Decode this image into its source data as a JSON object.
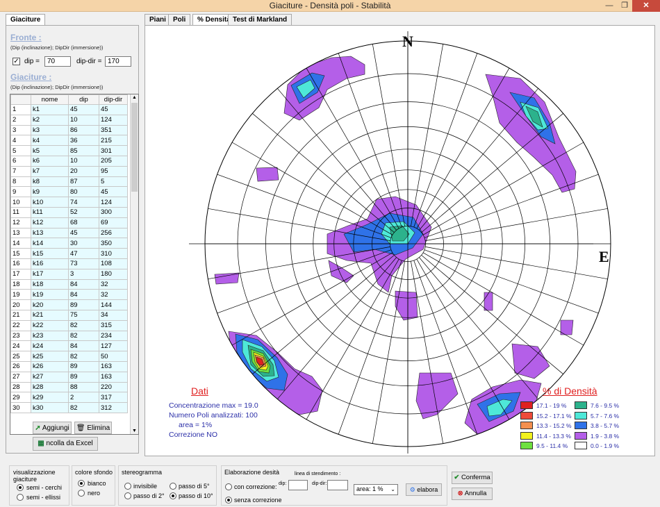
{
  "window": {
    "title": "Giaciture - Densità poli - Stabilità"
  },
  "left": {
    "tab": "Giaciture",
    "fronte_label": "Fronte :",
    "fronte_hint": "(Dip (inclinazione); DipDir (immersione))",
    "dip_label": "dip =",
    "dip_value": "70",
    "dipdir_label": "dip-dir =",
    "dipdir_value": "170",
    "giaciture_label": "Giaciture :",
    "giaciture_hint": "(Dip (inclinazione); DipDir (immersione))",
    "columns": [
      "nome",
      "dip",
      "dip-dir"
    ],
    "rows": [
      [
        "1",
        "k1",
        "45",
        "45"
      ],
      [
        "2",
        "k2",
        "10",
        "124"
      ],
      [
        "3",
        "k3",
        "86",
        "351"
      ],
      [
        "4",
        "k4",
        "36",
        "215"
      ],
      [
        "5",
        "k5",
        "85",
        "301"
      ],
      [
        "6",
        "k6",
        "10",
        "205"
      ],
      [
        "7",
        "k7",
        "20",
        "95"
      ],
      [
        "8",
        "k8",
        "87",
        "5"
      ],
      [
        "9",
        "k9",
        "80",
        "45"
      ],
      [
        "10",
        "k10",
        "74",
        "124"
      ],
      [
        "11",
        "k11",
        "52",
        "300"
      ],
      [
        "12",
        "k12",
        "68",
        "69"
      ],
      [
        "13",
        "k13",
        "45",
        "256"
      ],
      [
        "14",
        "k14",
        "30",
        "350"
      ],
      [
        "15",
        "k15",
        "47",
        "310"
      ],
      [
        "16",
        "k16",
        "73",
        "108"
      ],
      [
        "17",
        "k17",
        "3",
        "180"
      ],
      [
        "18",
        "k18",
        "84",
        "32"
      ],
      [
        "19",
        "k19",
        "84",
        "32"
      ],
      [
        "20",
        "k20",
        "89",
        "144"
      ],
      [
        "21",
        "k21",
        "75",
        "34"
      ],
      [
        "22",
        "k22",
        "82",
        "315"
      ],
      [
        "23",
        "k23",
        "82",
        "234"
      ],
      [
        "24",
        "k24",
        "84",
        "127"
      ],
      [
        "25",
        "k25",
        "82",
        "50"
      ],
      [
        "26",
        "k26",
        "89",
        "163"
      ],
      [
        "27",
        "k27",
        "89",
        "163"
      ],
      [
        "28",
        "k28",
        "88",
        "220"
      ],
      [
        "29",
        "k29",
        "2",
        "317"
      ],
      [
        "30",
        "k30",
        "82",
        "312"
      ]
    ],
    "btn_add": "Aggiungi",
    "btn_delete": "Elimina",
    "btn_excel": "ncolla da Excel"
  },
  "tabs": [
    "Piani",
    "Poli",
    "% Densità",
    "Test di Markland"
  ],
  "stereo": {
    "north": "N",
    "east": "E",
    "dati_title": "Dati",
    "dati_lines": [
      "Concentrazione max = 19.0",
      "Numero Poli analizzati: 100",
      "area = 1%",
      "Correzione NO"
    ],
    "legend_title": "% di Densità",
    "legend": [
      {
        "label": "17.1 - 19 %",
        "color": "#e02020"
      },
      {
        "label": "15.2 - 17.1 %",
        "color": "#ee4a3a"
      },
      {
        "label": "13.3 - 15.2 %",
        "color": "#f49050"
      },
      {
        "label": "11.4 - 13.3 %",
        "color": "#f2f21e"
      },
      {
        "label": "9.5 - 11.4 %",
        "color": "#6ee040"
      },
      {
        "label": "7.6 - 9.5 %",
        "color": "#2cb28c"
      },
      {
        "label": "5.7 - 7.6 %",
        "color": "#4ee8d8"
      },
      {
        "label": "3.8 - 5.7 %",
        "color": "#2f72e8"
      },
      {
        "label": "1.9 - 3.8 %",
        "color": "#b45fe8"
      },
      {
        "label": "0.0 - 1.9 %",
        "color": "#ffffff"
      }
    ]
  },
  "bottom": {
    "vis_title": "visualizzazione giaciture",
    "vis_opts": [
      "semi - cerchi",
      "semi - ellissi"
    ],
    "sfondo_title": "colore sfondo",
    "sfondo_opts": [
      "bianco",
      "nero"
    ],
    "stereo_title": "stereogramma",
    "stereo_opts": [
      "invisibile",
      "passo di 2°",
      "passo di 5°",
      "passo di 10°"
    ],
    "elab_title": "Elaborazione desità",
    "elab_opts": [
      "con correzione:",
      "senza correzione"
    ],
    "linea_title": "linea di stendimento :",
    "dip_small": "dip:",
    "dipdir_small": "dip-dir:",
    "area_value": "area: 1 %",
    "elabora": "elabora",
    "conferma": "Conferma",
    "annulla": "Annulla"
  }
}
